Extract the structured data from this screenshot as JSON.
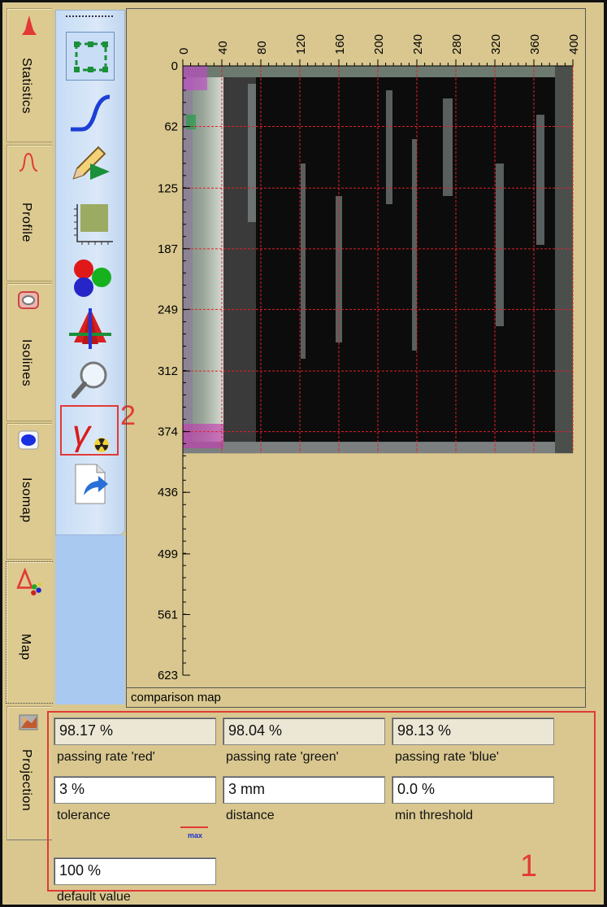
{
  "sidebar_tabs": [
    {
      "label": "Statistics",
      "icon": "statistics-icon"
    },
    {
      "label": "Profile",
      "icon": "profile-icon"
    },
    {
      "label": "Isolines",
      "icon": "isolines-icon"
    },
    {
      "label": "Isomap",
      "icon": "isomap-icon"
    },
    {
      "label": "Map",
      "icon": "map-delta-icon",
      "active": true
    },
    {
      "label": "Projection",
      "icon": "projection-icon"
    }
  ],
  "toolbar": {
    "tools": [
      "select-region-icon",
      "curve-icon",
      "pencil-annotate-icon",
      "image-grid-icon",
      "color-balls-icon",
      "pyramid-axes-icon",
      "magnifier-icon",
      "gamma-radiation-icon",
      "export-page-icon"
    ]
  },
  "annotations": {
    "marker_1": "1",
    "marker_2": "2"
  },
  "chart_data": {
    "type": "heatmap",
    "x_ticks": [
      "0",
      "40",
      "80",
      "120",
      "160",
      "200",
      "240",
      "280",
      "320",
      "360",
      "400"
    ],
    "y_ticks": [
      "0",
      "62",
      "125",
      "187",
      "249",
      "312",
      "374",
      "436",
      "499",
      "561",
      "623"
    ],
    "xlim": [
      0,
      400
    ],
    "ylim": [
      0,
      623
    ],
    "grid": true,
    "grid_color": "#e0202a",
    "image_extent": {
      "x": [
        0,
        400
      ],
      "y": [
        0,
        396
      ]
    }
  },
  "chart_caption": "comparison map",
  "form": {
    "passing_red": {
      "value": "98.17 %",
      "label": "passing rate 'red'"
    },
    "passing_green": {
      "value": "98.04 %",
      "label": "passing rate 'green'"
    },
    "passing_blue": {
      "value": "98.13 %",
      "label": "passing rate 'blue'"
    },
    "tolerance": {
      "value": "3 %",
      "label": "tolerance"
    },
    "distance": {
      "value": "3 mm",
      "label": "distance"
    },
    "min_threshold": {
      "value": "0.0 %",
      "label": "min threshold"
    },
    "default_value": {
      "value": "100 %",
      "label": "default value"
    },
    "max_indicator": "max"
  },
  "colors": {
    "accent_red": "#e23a36",
    "panel_bg": "#d9c78f",
    "toolbar_bg": "#dae8f8"
  }
}
